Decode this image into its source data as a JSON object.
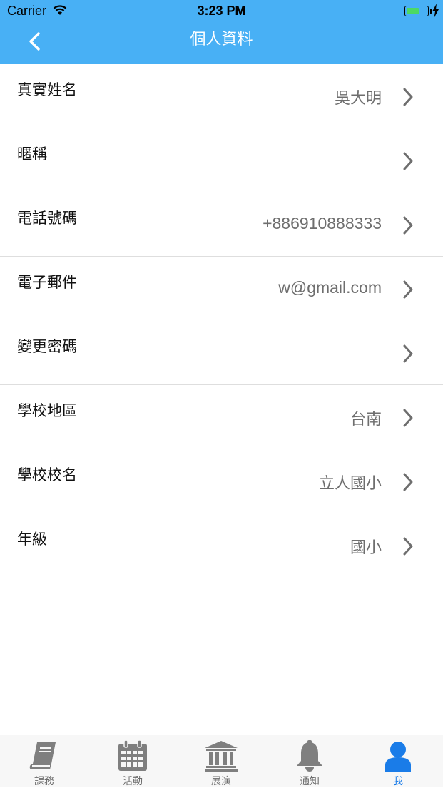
{
  "status_bar": {
    "carrier": "Carrier",
    "time": "3:23 PM",
    "battery_color": "#4cd964"
  },
  "nav": {
    "title": "個人資料",
    "back_icon": "chevron-left-icon",
    "background": "#48b0f5"
  },
  "rows": [
    {
      "label": "真實姓名",
      "value": "吳大明"
    },
    {
      "label": "暱稱",
      "value": ""
    },
    {
      "label": "電話號碼",
      "value": "+886910888333"
    },
    {
      "label": "電子郵件",
      "value": "w@gmail.com"
    },
    {
      "label": "變更密碼",
      "value": ""
    },
    {
      "label": "學校地區",
      "value": "台南"
    },
    {
      "label": "學校校名",
      "value": "立人國小"
    },
    {
      "label": "年級",
      "value": "國小"
    }
  ],
  "tabs": [
    {
      "label": "課務",
      "icon": "book-icon"
    },
    {
      "label": "活動",
      "icon": "calendar-icon"
    },
    {
      "label": "展演",
      "icon": "museum-icon"
    },
    {
      "label": "通知",
      "icon": "bell-icon"
    },
    {
      "label": "我",
      "icon": "user-icon",
      "active": true
    }
  ],
  "colors": {
    "accent": "#1a7ce8",
    "inactive_icon": "#7f7f7f"
  }
}
